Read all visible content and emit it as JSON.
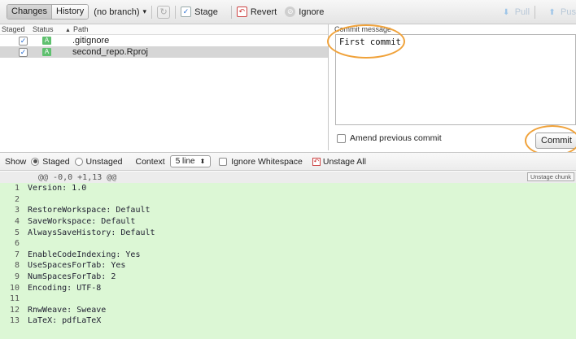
{
  "toolbar": {
    "tabs": [
      {
        "label": "Changes",
        "active": true
      },
      {
        "label": "History",
        "active": false
      }
    ],
    "branch": "(no branch)",
    "branch_caret": "▾",
    "stage_label": "Stage",
    "revert_label": "Revert",
    "ignore_label": "Ignore",
    "pull_label": "Pull",
    "push_label": "Pus",
    "icons": {
      "refresh": "refresh-icon",
      "stage": "check-icon",
      "revert": "revert-icon",
      "ignore": "ignore-icon",
      "pull": "pull-arrow-icon",
      "push": "push-arrow-icon"
    }
  },
  "files": {
    "headers": {
      "staged": "Staged",
      "status": "Status",
      "path": "Path",
      "sort_icon": "▲"
    },
    "rows": [
      {
        "staged": true,
        "status": "A",
        "path": ".gitignore",
        "selected": false
      },
      {
        "staged": true,
        "status": "A",
        "path": "second_repo.Rproj",
        "selected": true
      }
    ]
  },
  "commit": {
    "label": "Commit message",
    "message": "First commit",
    "amend_label": "Amend previous commit",
    "amend_checked": false,
    "button_label": "Commit"
  },
  "diff_toolbar": {
    "show_label": "Show",
    "staged_label": "Staged",
    "unstaged_label": "Unstaged",
    "selected": "Staged",
    "context_label": "Context",
    "context_value": "5 line",
    "context_arrow": "⬍",
    "ignore_whitespace_label": "Ignore Whitespace",
    "unstage_all_label": "Unstage All"
  },
  "diff": {
    "hunk_header": "@@ -0,0 +1,13 @@",
    "unstage_chunk_label": "Unstage chunk",
    "lines": [
      {
        "n": "1",
        "text": "Version: 1.0"
      },
      {
        "n": "2",
        "text": ""
      },
      {
        "n": "3",
        "text": "RestoreWorkspace: Default"
      },
      {
        "n": "4",
        "text": "SaveWorkspace: Default"
      },
      {
        "n": "5",
        "text": "AlwaysSaveHistory: Default"
      },
      {
        "n": "6",
        "text": ""
      },
      {
        "n": "7",
        "text": "EnableCodeIndexing: Yes"
      },
      {
        "n": "8",
        "text": "UseSpacesForTab: Yes"
      },
      {
        "n": "9",
        "text": "NumSpacesForTab: 2"
      },
      {
        "n": "10",
        "text": "Encoding: UTF-8"
      },
      {
        "n": "11",
        "text": ""
      },
      {
        "n": "12",
        "text": "RnwWeave: Sweave"
      },
      {
        "n": "13",
        "text": "LaTeX: pdfLaTeX"
      }
    ]
  },
  "colors": {
    "added_bg": "#dcf7d5",
    "annotation": "#f0a23a",
    "status_added": "#5fc06f"
  }
}
